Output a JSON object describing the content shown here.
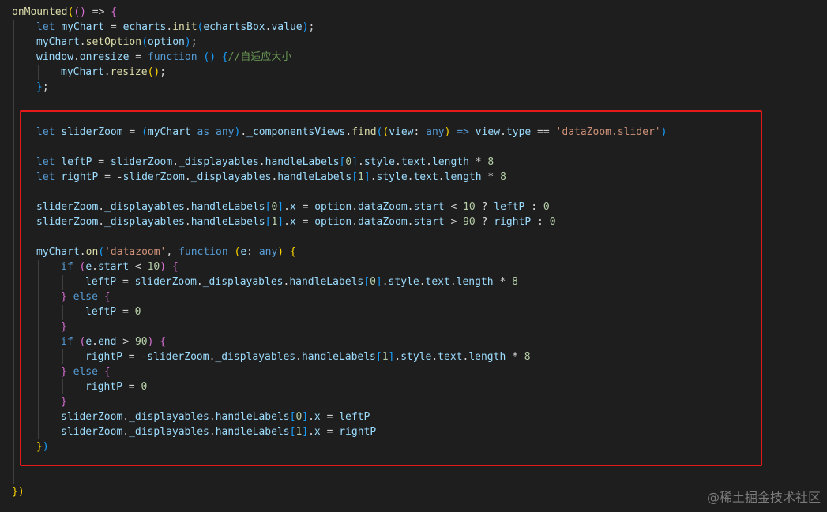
{
  "editor": {
    "lines": [
      {
        "indent": 0,
        "tokens": [
          [
            "fn",
            "onMounted"
          ],
          [
            "br1",
            "("
          ],
          [
            "br2",
            "("
          ],
          [
            "br2",
            ")"
          ],
          [
            "op",
            " => "
          ],
          [
            "br2",
            "{"
          ]
        ]
      },
      {
        "indent": 1,
        "tokens": [
          [
            "kw",
            "let"
          ],
          [
            "op",
            " "
          ],
          [
            "var",
            "myChart"
          ],
          [
            "op",
            " = "
          ],
          [
            "var",
            "echarts"
          ],
          [
            "op",
            "."
          ],
          [
            "fn",
            "init"
          ],
          [
            "br3",
            "("
          ],
          [
            "var",
            "echartsBox"
          ],
          [
            "op",
            "."
          ],
          [
            "var",
            "value"
          ],
          [
            "br3",
            ")"
          ],
          [
            "op",
            ";"
          ]
        ]
      },
      {
        "indent": 1,
        "tokens": [
          [
            "var",
            "myChart"
          ],
          [
            "op",
            "."
          ],
          [
            "fn",
            "setOption"
          ],
          [
            "br3",
            "("
          ],
          [
            "var",
            "option"
          ],
          [
            "br3",
            ")"
          ],
          [
            "op",
            ";"
          ]
        ]
      },
      {
        "indent": 1,
        "tokens": [
          [
            "var",
            "window"
          ],
          [
            "op",
            "."
          ],
          [
            "var",
            "onresize"
          ],
          [
            "op",
            " = "
          ],
          [
            "kw",
            "function"
          ],
          [
            "op",
            " "
          ],
          [
            "br3",
            "("
          ],
          [
            "br3",
            ")"
          ],
          [
            "op",
            " "
          ],
          [
            "br3",
            "{"
          ],
          [
            "cmt",
            "//自适应大小"
          ]
        ]
      },
      {
        "indent": 2,
        "tokens": [
          [
            "var",
            "myChart"
          ],
          [
            "op",
            "."
          ],
          [
            "fn",
            "resize"
          ],
          [
            "br1",
            "("
          ],
          [
            "br1",
            ")"
          ],
          [
            "op",
            ";"
          ]
        ]
      },
      {
        "indent": 1,
        "tokens": [
          [
            "br3",
            "}"
          ],
          [
            "op",
            ";"
          ]
        ]
      },
      {
        "indent": 0,
        "tokens": []
      },
      {
        "indent": 0,
        "tokens": []
      },
      {
        "indent": 1,
        "tokens": [
          [
            "kw",
            "let"
          ],
          [
            "op",
            " "
          ],
          [
            "var",
            "sliderZoom"
          ],
          [
            "op",
            " = "
          ],
          [
            "br3",
            "("
          ],
          [
            "var",
            "myChart"
          ],
          [
            "op",
            " "
          ],
          [
            "kw",
            "as"
          ],
          [
            "op",
            " "
          ],
          [
            "kw",
            "any"
          ],
          [
            "br3",
            ")"
          ],
          [
            "op",
            "."
          ],
          [
            "var",
            "_componentsViews"
          ],
          [
            "op",
            "."
          ],
          [
            "fn",
            "find"
          ],
          [
            "br3",
            "("
          ],
          [
            "br1",
            "("
          ],
          [
            "var",
            "view"
          ],
          [
            "op",
            ": "
          ],
          [
            "kw",
            "any"
          ],
          [
            "br1",
            ")"
          ],
          [
            "op",
            " "
          ],
          [
            "kw",
            "=>"
          ],
          [
            "op",
            " "
          ],
          [
            "var",
            "view"
          ],
          [
            "op",
            "."
          ],
          [
            "var",
            "type"
          ],
          [
            "op",
            " == "
          ],
          [
            "str",
            "'dataZoom.slider'"
          ],
          [
            "br3",
            ")"
          ]
        ]
      },
      {
        "indent": 0,
        "tokens": []
      },
      {
        "indent": 1,
        "tokens": [
          [
            "kw",
            "let"
          ],
          [
            "op",
            " "
          ],
          [
            "var",
            "leftP"
          ],
          [
            "op",
            " = "
          ],
          [
            "var",
            "sliderZoom"
          ],
          [
            "op",
            "."
          ],
          [
            "var",
            "_displayables"
          ],
          [
            "op",
            "."
          ],
          [
            "var",
            "handleLabels"
          ],
          [
            "br3",
            "["
          ],
          [
            "num",
            "0"
          ],
          [
            "br3",
            "]"
          ],
          [
            "op",
            "."
          ],
          [
            "var",
            "style"
          ],
          [
            "op",
            "."
          ],
          [
            "var",
            "text"
          ],
          [
            "op",
            "."
          ],
          [
            "var",
            "length"
          ],
          [
            "op",
            " * "
          ],
          [
            "num",
            "8"
          ]
        ]
      },
      {
        "indent": 1,
        "tokens": [
          [
            "kw",
            "let"
          ],
          [
            "op",
            " "
          ],
          [
            "var",
            "rightP"
          ],
          [
            "op",
            " = -"
          ],
          [
            "var",
            "sliderZoom"
          ],
          [
            "op",
            "."
          ],
          [
            "var",
            "_displayables"
          ],
          [
            "op",
            "."
          ],
          [
            "var",
            "handleLabels"
          ],
          [
            "br3",
            "["
          ],
          [
            "num",
            "1"
          ],
          [
            "br3",
            "]"
          ],
          [
            "op",
            "."
          ],
          [
            "var",
            "style"
          ],
          [
            "op",
            "."
          ],
          [
            "var",
            "text"
          ],
          [
            "op",
            "."
          ],
          [
            "var",
            "length"
          ],
          [
            "op",
            " * "
          ],
          [
            "num",
            "8"
          ]
        ]
      },
      {
        "indent": 0,
        "tokens": []
      },
      {
        "indent": 1,
        "tokens": [
          [
            "var",
            "sliderZoom"
          ],
          [
            "op",
            "."
          ],
          [
            "var",
            "_displayables"
          ],
          [
            "op",
            "."
          ],
          [
            "var",
            "handleLabels"
          ],
          [
            "br3",
            "["
          ],
          [
            "num",
            "0"
          ],
          [
            "br3",
            "]"
          ],
          [
            "op",
            "."
          ],
          [
            "var",
            "x"
          ],
          [
            "op",
            " = "
          ],
          [
            "var",
            "option"
          ],
          [
            "op",
            "."
          ],
          [
            "var",
            "dataZoom"
          ],
          [
            "op",
            "."
          ],
          [
            "var",
            "start"
          ],
          [
            "op",
            " < "
          ],
          [
            "num",
            "10"
          ],
          [
            "op",
            " ? "
          ],
          [
            "var",
            "leftP"
          ],
          [
            "op",
            " : "
          ],
          [
            "num",
            "0"
          ]
        ]
      },
      {
        "indent": 1,
        "tokens": [
          [
            "var",
            "sliderZoom"
          ],
          [
            "op",
            "."
          ],
          [
            "var",
            "_displayables"
          ],
          [
            "op",
            "."
          ],
          [
            "var",
            "handleLabels"
          ],
          [
            "br3",
            "["
          ],
          [
            "num",
            "1"
          ],
          [
            "br3",
            "]"
          ],
          [
            "op",
            "."
          ],
          [
            "var",
            "x"
          ],
          [
            "op",
            " = "
          ],
          [
            "var",
            "option"
          ],
          [
            "op",
            "."
          ],
          [
            "var",
            "dataZoom"
          ],
          [
            "op",
            "."
          ],
          [
            "var",
            "start"
          ],
          [
            "op",
            " > "
          ],
          [
            "num",
            "90"
          ],
          [
            "op",
            " ? "
          ],
          [
            "var",
            "rightP"
          ],
          [
            "op",
            " : "
          ],
          [
            "num",
            "0"
          ]
        ]
      },
      {
        "indent": 0,
        "tokens": []
      },
      {
        "indent": 1,
        "tokens": [
          [
            "var",
            "myChart"
          ],
          [
            "op",
            "."
          ],
          [
            "fn",
            "on"
          ],
          [
            "br3",
            "("
          ],
          [
            "str",
            "'datazoom'"
          ],
          [
            "op",
            ", "
          ],
          [
            "kw",
            "function"
          ],
          [
            "op",
            " "
          ],
          [
            "br1",
            "("
          ],
          [
            "var",
            "e"
          ],
          [
            "op",
            ": "
          ],
          [
            "kw",
            "any"
          ],
          [
            "br1",
            ")"
          ],
          [
            "op",
            " "
          ],
          [
            "br1",
            "{"
          ]
        ]
      },
      {
        "indent": 2,
        "tokens": [
          [
            "kw",
            "if"
          ],
          [
            "op",
            " "
          ],
          [
            "br2",
            "("
          ],
          [
            "var",
            "e"
          ],
          [
            "op",
            "."
          ],
          [
            "var",
            "start"
          ],
          [
            "op",
            " < "
          ],
          [
            "num",
            "10"
          ],
          [
            "br2",
            ")"
          ],
          [
            "op",
            " "
          ],
          [
            "br2",
            "{"
          ]
        ]
      },
      {
        "indent": 3,
        "tokens": [
          [
            "var",
            "leftP"
          ],
          [
            "op",
            " = "
          ],
          [
            "var",
            "sliderZoom"
          ],
          [
            "op",
            "."
          ],
          [
            "var",
            "_displayables"
          ],
          [
            "op",
            "."
          ],
          [
            "var",
            "handleLabels"
          ],
          [
            "br3",
            "["
          ],
          [
            "num",
            "0"
          ],
          [
            "br3",
            "]"
          ],
          [
            "op",
            "."
          ],
          [
            "var",
            "style"
          ],
          [
            "op",
            "."
          ],
          [
            "var",
            "text"
          ],
          [
            "op",
            "."
          ],
          [
            "var",
            "length"
          ],
          [
            "op",
            " * "
          ],
          [
            "num",
            "8"
          ]
        ]
      },
      {
        "indent": 2,
        "tokens": [
          [
            "br2",
            "}"
          ],
          [
            "op",
            " "
          ],
          [
            "kw",
            "else"
          ],
          [
            "op",
            " "
          ],
          [
            "br2",
            "{"
          ]
        ]
      },
      {
        "indent": 3,
        "tokens": [
          [
            "var",
            "leftP"
          ],
          [
            "op",
            " = "
          ],
          [
            "num",
            "0"
          ]
        ]
      },
      {
        "indent": 2,
        "tokens": [
          [
            "br2",
            "}"
          ]
        ]
      },
      {
        "indent": 2,
        "tokens": [
          [
            "kw",
            "if"
          ],
          [
            "op",
            " "
          ],
          [
            "br2",
            "("
          ],
          [
            "var",
            "e"
          ],
          [
            "op",
            "."
          ],
          [
            "var",
            "end"
          ],
          [
            "op",
            " > "
          ],
          [
            "num",
            "90"
          ],
          [
            "br2",
            ")"
          ],
          [
            "op",
            " "
          ],
          [
            "br2",
            "{"
          ]
        ]
      },
      {
        "indent": 3,
        "tokens": [
          [
            "var",
            "rightP"
          ],
          [
            "op",
            " = -"
          ],
          [
            "var",
            "sliderZoom"
          ],
          [
            "op",
            "."
          ],
          [
            "var",
            "_displayables"
          ],
          [
            "op",
            "."
          ],
          [
            "var",
            "handleLabels"
          ],
          [
            "br3",
            "["
          ],
          [
            "num",
            "1"
          ],
          [
            "br3",
            "]"
          ],
          [
            "op",
            "."
          ],
          [
            "var",
            "style"
          ],
          [
            "op",
            "."
          ],
          [
            "var",
            "text"
          ],
          [
            "op",
            "."
          ],
          [
            "var",
            "length"
          ],
          [
            "op",
            " * "
          ],
          [
            "num",
            "8"
          ]
        ]
      },
      {
        "indent": 2,
        "tokens": [
          [
            "br2",
            "}"
          ],
          [
            "op",
            " "
          ],
          [
            "kw",
            "else"
          ],
          [
            "op",
            " "
          ],
          [
            "br2",
            "{"
          ]
        ]
      },
      {
        "indent": 3,
        "tokens": [
          [
            "var",
            "rightP"
          ],
          [
            "op",
            " = "
          ],
          [
            "num",
            "0"
          ]
        ]
      },
      {
        "indent": 2,
        "tokens": [
          [
            "br2",
            "}"
          ]
        ]
      },
      {
        "indent": 2,
        "tokens": [
          [
            "var",
            "sliderZoom"
          ],
          [
            "op",
            "."
          ],
          [
            "var",
            "_displayables"
          ],
          [
            "op",
            "."
          ],
          [
            "var",
            "handleLabels"
          ],
          [
            "br3",
            "["
          ],
          [
            "num",
            "0"
          ],
          [
            "br3",
            "]"
          ],
          [
            "op",
            "."
          ],
          [
            "var",
            "x"
          ],
          [
            "op",
            " = "
          ],
          [
            "var",
            "leftP"
          ]
        ]
      },
      {
        "indent": 2,
        "tokens": [
          [
            "var",
            "sliderZoom"
          ],
          [
            "op",
            "."
          ],
          [
            "var",
            "_displayables"
          ],
          [
            "op",
            "."
          ],
          [
            "var",
            "handleLabels"
          ],
          [
            "br3",
            "["
          ],
          [
            "num",
            "1"
          ],
          [
            "br3",
            "]"
          ],
          [
            "op",
            "."
          ],
          [
            "var",
            "x"
          ],
          [
            "op",
            " = "
          ],
          [
            "var",
            "rightP"
          ]
        ]
      },
      {
        "indent": 1,
        "tokens": [
          [
            "br1",
            "}"
          ],
          [
            "br3",
            ")"
          ]
        ]
      },
      {
        "indent": 0,
        "tokens": []
      },
      {
        "indent": 0,
        "tokens": []
      },
      {
        "indent": 0,
        "tokens": [
          [
            "br1",
            "}"
          ],
          [
            "br1",
            ")"
          ]
        ]
      }
    ]
  },
  "colors": {
    "background": "#1e1e1e",
    "keyword": "#569cd6",
    "function": "#dcdcaa",
    "variable": "#9cdcfe",
    "string": "#ce9178",
    "number": "#b5cea8",
    "comment": "#6a9955",
    "highlight_border": "#e5191a"
  },
  "watermark": {
    "text": "@稀土掘金技术社区"
  }
}
